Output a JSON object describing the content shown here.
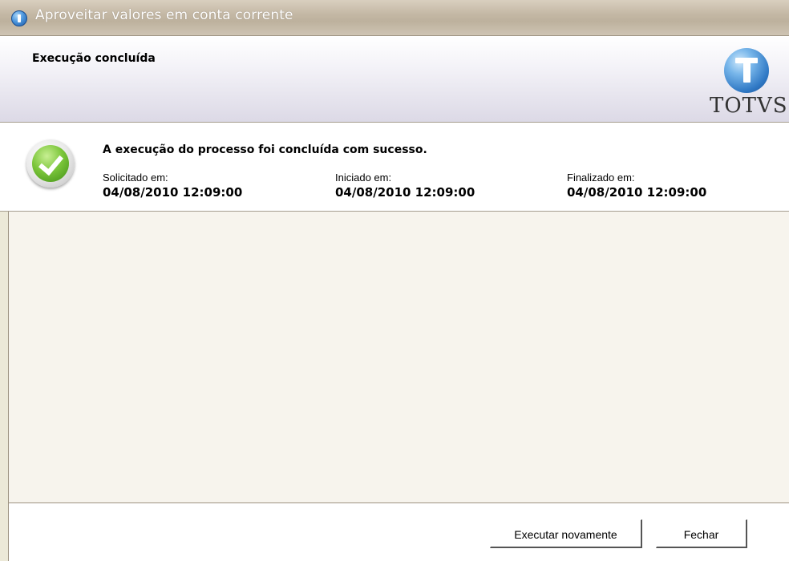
{
  "window": {
    "title": "Aproveitar valores em conta corrente",
    "app_icon": "totvs-globe-icon"
  },
  "header": {
    "title": "Execução concluída",
    "logo_text": "TOTVS",
    "logo_icon": "totvs-logo-icon"
  },
  "status": {
    "icon": "success-check-icon",
    "message": "A execução do processo foi concluída com sucesso.",
    "requested_label": "Solicitado em:",
    "requested_value": "04/08/2010 12:09:00",
    "started_label": "Iniciado em:",
    "started_value": "04/08/2010 12:09:00",
    "finished_label": "Finalizado em:",
    "finished_value": "04/08/2010 12:09:00"
  },
  "footer": {
    "run_again_label": "Executar novamente",
    "close_label": "Fechar"
  },
  "colors": {
    "window_bg": "#ece9d8",
    "content_bg": "#f7f4ed",
    "success_green": "#7cc63b",
    "logo_blue": "#2f78c4"
  }
}
